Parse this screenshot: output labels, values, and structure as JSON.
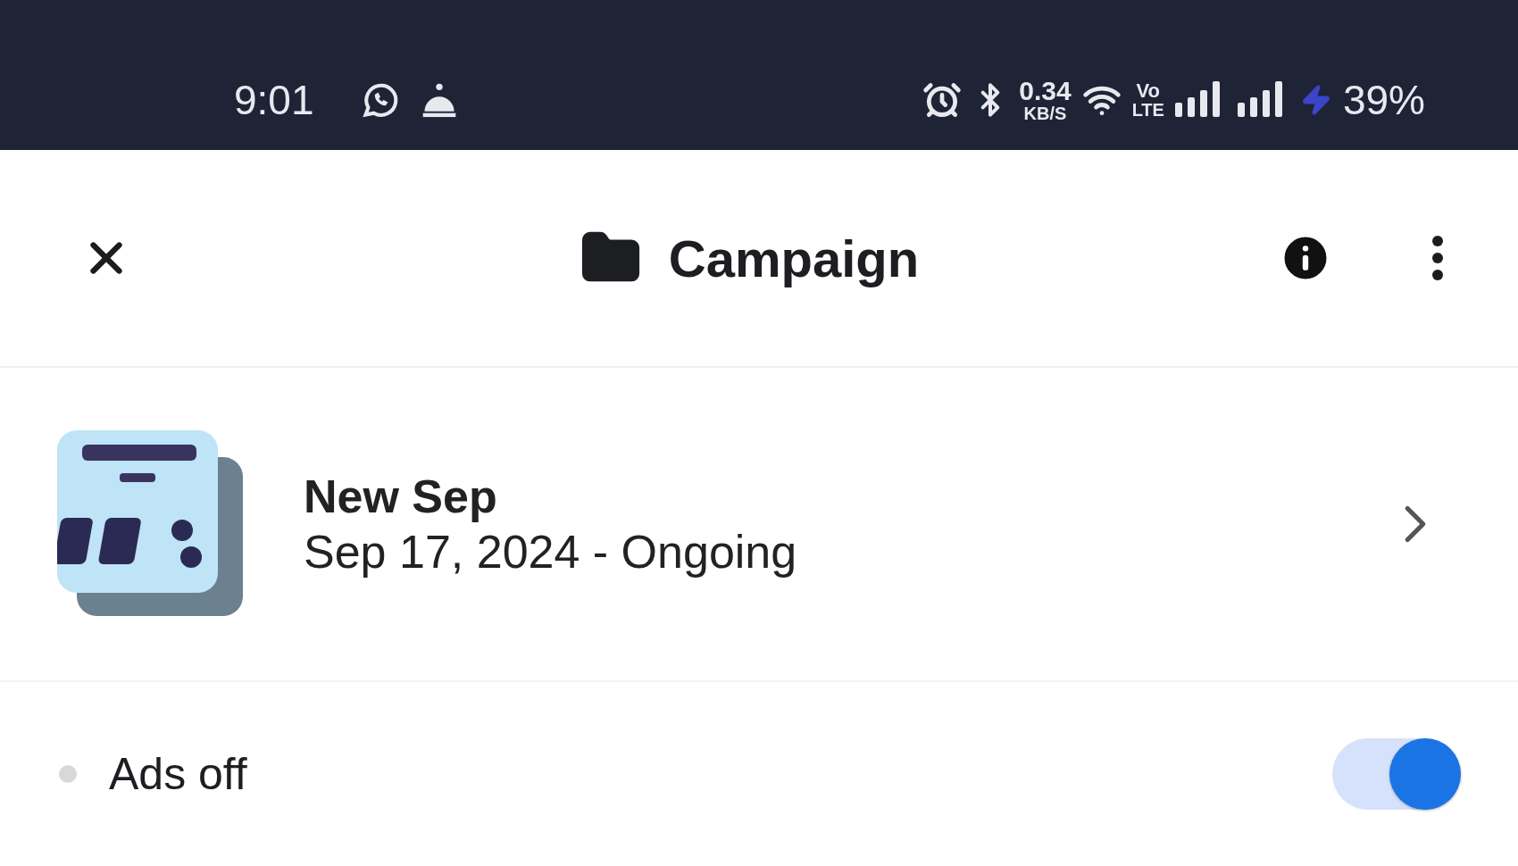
{
  "status_bar": {
    "time": "9:01",
    "net_speed": "0.34",
    "net_unit": "KB/S",
    "volte": "Vo",
    "lte": "LTE",
    "battery": "39%"
  },
  "header": {
    "title": "Campaign"
  },
  "campaign": {
    "name": "New Sep",
    "dates": "Sep 17, 2024 -  Ongoing"
  },
  "ads_row": {
    "label": "Ads off",
    "on": true
  }
}
